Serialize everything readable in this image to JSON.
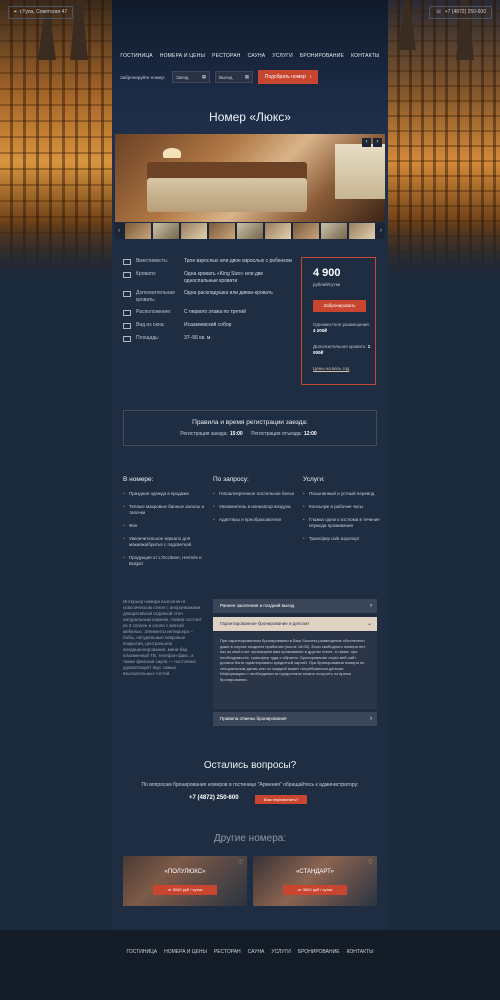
{
  "header": {
    "location": "г.Тула, Советская 47",
    "phone": "+7 (4872) 250-600",
    "logo_name": "",
    "logo_caption": ""
  },
  "nav": [
    "ГОСТИНИЦА",
    "НОМЕРА И ЦЕНЫ",
    "РЕСТОРАН",
    "САУНА",
    "УСЛУГИ",
    "БРОНИРОВАНИЕ",
    "КОНТАКТЫ"
  ],
  "booking": {
    "label": "Забронируйте номер:",
    "checkin": "Заезд",
    "checkout": "Выезд",
    "button": "Подобрать номер"
  },
  "room": {
    "title": "Номер «Люкс»",
    "specs": [
      {
        "name": "Вместимость:",
        "value": "Трое взрослых или двое взрослых с ребенком"
      },
      {
        "name": "Кровати:",
        "value": "Одна кровать «King Size» или две односпальные кровати"
      },
      {
        "name": "Дополнительная кровать:",
        "value": "Одна раскладушка или диван-кровать"
      },
      {
        "name": "Расположение:",
        "value": "С первого этажа по третий"
      },
      {
        "name": "Вид из окна:",
        "value": "Исаакиевский собор"
      },
      {
        "name": "Площадь:",
        "value": "37–56 кв. м."
      }
    ]
  },
  "price": {
    "amount": "4 900",
    "unit": "рублей/сутки",
    "button": "Забронировать",
    "single_label": "Одноместное размещение:",
    "single_value": "4 200₽",
    "extra_label": "Дополнительная кровать:",
    "extra_value": "1 000₽",
    "link": "Цены на весь год"
  },
  "checkin": {
    "title": "Правила и время регистрации заезда:",
    "in_label": "Регистрация заезда:",
    "in_time": "15:00",
    "out_label": "Регистрация отъезда:",
    "out_time": "12:00"
  },
  "amenities": {
    "in_room_title": "В номере:",
    "in_room": [
      "Праздная одежда в продаже",
      "Теплые махровые банные халаты и тапочки",
      "Фен",
      "Увеличительное зеркало для макияжа/бритья с подсветкой",
      "Продукция от L'Occitane, Hermès и Bulgari"
    ],
    "request_title": "По запросу:",
    "request": [
      "Гипоаллергенное постельное белье",
      "Увлажнитель и ионизатор воздуха",
      "Адаптеры и преобразователи"
    ],
    "services_title": "Услуги:",
    "services": [
      "Пасынанный и устный перевод",
      "Консьерж в рабочие часы",
      "Глажка одного костюма в течение периода проживания",
      "Трансфер из/в аэропорт"
    ]
  },
  "description": "Интерьер номера выполнен в классическом стиле с анхронизмами декоративной отделкой стен натуральным камнем. Номер состоит из 2 спален и холла с мягкой мебелью. Элементы интерьера – бобы, натуральные ковровые покрытия, центральное кондиционирование, мини-бар, плазменный ТВ, телефон-факс, а также финская сауна — постоянно удовлетворят вкус самых взыскательных гостей.",
  "accordion": {
    "item1": "Раннее заселение и поздний выезд",
    "item2": "Гарантированное бронирование и депозит",
    "item2_body": "При гарантированном бронировании в Ваш Success размещение обеспечено даже в случае позднего прибытия (после 18:00). Если свободного номера нет, мы за свой счет организуем вам проживание в другом отеле, а также, при необходимости, трансфер туда и обратно. Бронирование через веб-сайт должно быть гарантировано кредитной картой. При бронировании номера по специальным датам или со скидкой может потребоваться депозит. Информацию о необходимости предоплаты можно получить из время бронирования.",
    "item3": "Правила отмены бронирования"
  },
  "questions": {
    "title": "Остались вопросы?",
    "text": "По вопросам бронирования номеров в гостинице \"Армения\" обращайтесь к администратору:",
    "phone": "+7 (4872) 250-600",
    "button": "Вам перезвонить?"
  },
  "other": {
    "title": "Другие номера:",
    "rooms": [
      {
        "name": "«ПОЛУЛЮКС»",
        "price": "от 5000 руб / сутки"
      },
      {
        "name": "«СТАНДАРТ»",
        "price": "от 3600 руб / сутки"
      }
    ]
  },
  "footer": {
    "nav": [
      "ГОСТИНИЦА",
      "НОМЕРА И ЦЕНЫ",
      "РЕСТОРАН",
      "САУНА",
      "УСЛУГИ",
      "БРОНИРОВАНИЕ",
      "КОНТАКТЫ"
    ],
    "lines": [
      "",
      "",
      "",
      ""
    ]
  },
  "colors": {
    "accent": "#c8452f",
    "bg": "#1c2a3d",
    "panel": "#1e2d42"
  }
}
